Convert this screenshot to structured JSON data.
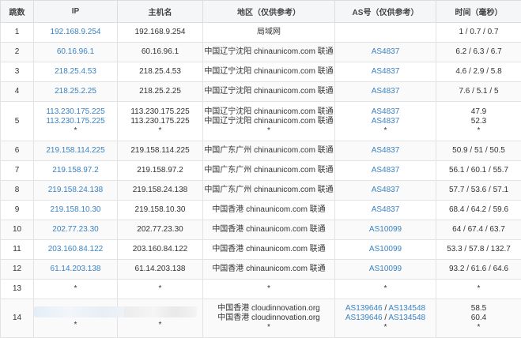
{
  "headers": {
    "hop": "跳数",
    "ip": "IP",
    "host": "主机名",
    "region": "地区（仅供参考）",
    "asn": "AS号（仅供参考）",
    "time": "时间（毫秒）"
  },
  "rows": [
    {
      "hop": "1",
      "ip": [
        "192.168.9.254"
      ],
      "host": [
        "192.168.9.254"
      ],
      "region": [
        "局域网"
      ],
      "asn": [
        []
      ],
      "time": [
        "1 / 0.7 / 0.7"
      ]
    },
    {
      "hop": "2",
      "ip": [
        "60.16.96.1"
      ],
      "host": [
        "60.16.96.1"
      ],
      "region": [
        "中国辽宁沈阳 chinaunicom.com 联通"
      ],
      "asn": [
        [
          "AS4837"
        ]
      ],
      "time": [
        "6.2 / 6.3 / 6.7"
      ]
    },
    {
      "hop": "3",
      "ip": [
        "218.25.4.53"
      ],
      "host": [
        "218.25.4.53"
      ],
      "region": [
        "中国辽宁沈阳 chinaunicom.com 联通"
      ],
      "asn": [
        [
          "AS4837"
        ]
      ],
      "time": [
        "4.6 / 2.9 / 5.8"
      ]
    },
    {
      "hop": "4",
      "ip": [
        "218.25.2.25"
      ],
      "host": [
        "218.25.2.25"
      ],
      "region": [
        "中国辽宁沈阳 chinaunicom.com 联通"
      ],
      "asn": [
        [
          "AS4837"
        ]
      ],
      "time": [
        "7.6 / 5.1 / 5"
      ]
    },
    {
      "hop": "5",
      "ip": [
        "113.230.175.225",
        "113.230.175.225",
        "*"
      ],
      "host": [
        "113.230.175.225",
        "113.230.175.225",
        "*"
      ],
      "region": [
        "中国辽宁沈阳 chinaunicom.com 联通",
        "中国辽宁沈阳 chinaunicom.com 联通",
        "*"
      ],
      "asn": [
        [
          "AS4837"
        ],
        [
          "AS4837"
        ],
        [
          "*"
        ]
      ],
      "time": [
        "47.9",
        "52.3",
        "*"
      ]
    },
    {
      "hop": "6",
      "ip": [
        "219.158.114.225"
      ],
      "host": [
        "219.158.114.225"
      ],
      "region": [
        "中国广东广州 chinaunicom.com 联通"
      ],
      "asn": [
        [
          "AS4837"
        ]
      ],
      "time": [
        "50.9 / 51 / 50.5"
      ]
    },
    {
      "hop": "7",
      "ip": [
        "219.158.97.2"
      ],
      "host": [
        "219.158.97.2"
      ],
      "region": [
        "中国广东广州 chinaunicom.com 联通"
      ],
      "asn": [
        [
          "AS4837"
        ]
      ],
      "time": [
        "56.1 / 60.1 / 55.7"
      ]
    },
    {
      "hop": "8",
      "ip": [
        "219.158.24.138"
      ],
      "host": [
        "219.158.24.138"
      ],
      "region": [
        "中国广东广州 chinaunicom.com 联通"
      ],
      "asn": [
        [
          "AS4837"
        ]
      ],
      "time": [
        "57.7 / 53.6 / 57.1"
      ]
    },
    {
      "hop": "9",
      "ip": [
        "219.158.10.30"
      ],
      "host": [
        "219.158.10.30"
      ],
      "region": [
        "中国香港 chinaunicom.com 联通"
      ],
      "asn": [
        [
          "AS4837"
        ]
      ],
      "time": [
        "68.4 / 64.2 / 59.6"
      ]
    },
    {
      "hop": "10",
      "ip": [
        "202.77.23.30"
      ],
      "host": [
        "202.77.23.30"
      ],
      "region": [
        "中国香港 chinaunicom.com 联通"
      ],
      "asn": [
        [
          "AS10099"
        ]
      ],
      "time": [
        "64 / 67.4 / 63.7"
      ]
    },
    {
      "hop": "11",
      "ip": [
        "203.160.84.122"
      ],
      "host": [
        "203.160.84.122"
      ],
      "region": [
        "中国香港 chinaunicom.com 联通"
      ],
      "asn": [
        [
          "AS10099"
        ]
      ],
      "time": [
        "53.3 / 57.8 / 132.7"
      ]
    },
    {
      "hop": "12",
      "ip": [
        "61.14.203.138"
      ],
      "host": [
        "61.14.203.138"
      ],
      "region": [
        "中国香港 chinaunicom.com 联通"
      ],
      "asn": [
        [
          "AS10099"
        ]
      ],
      "time": [
        "93.2 / 61.6 / 64.6"
      ]
    },
    {
      "hop": "13",
      "ip": [
        "*"
      ],
      "host": [
        "*"
      ],
      "region": [
        "*"
      ],
      "asn": [
        [
          "*"
        ]
      ],
      "time": [
        "*"
      ]
    },
    {
      "hop": "14",
      "ip": [
        "",
        "",
        "*"
      ],
      "host": [
        "",
        "",
        "*"
      ],
      "region": [
        "中国香港 cloudinnovation.org",
        "中国香港 cloudinnovation.org",
        "*"
      ],
      "asn": [
        [
          "AS139646",
          "AS134548"
        ],
        [
          "AS139646",
          "AS134548"
        ],
        [
          "*"
        ]
      ],
      "time": [
        "58.5",
        "60.4",
        "*"
      ]
    }
  ],
  "colors": {
    "link": "#3a83c4",
    "header_bg": "#f5f6f7",
    "border": "#dddddd"
  }
}
